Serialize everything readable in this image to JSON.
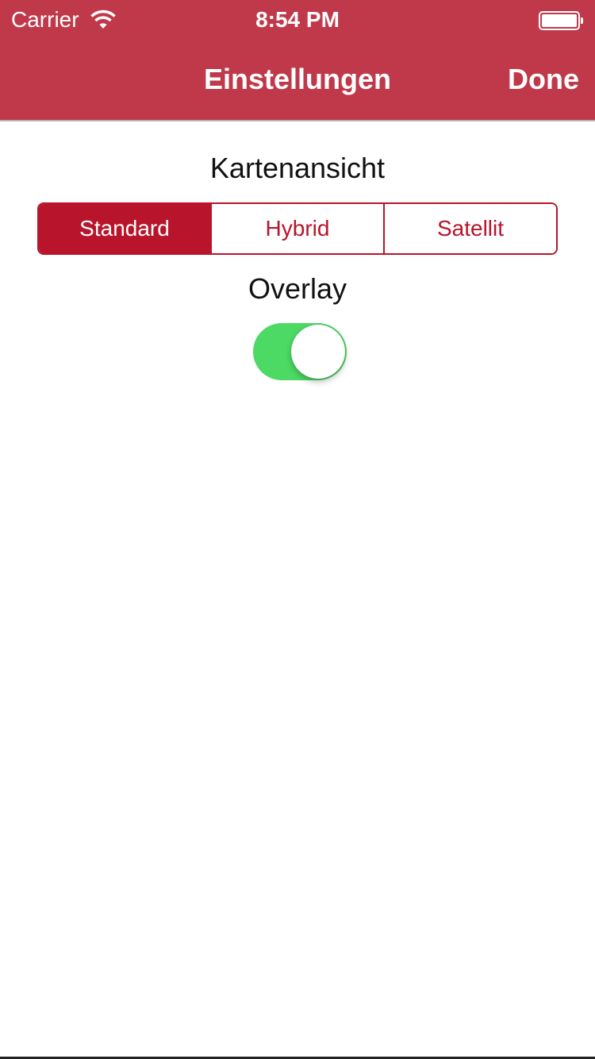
{
  "status_bar": {
    "carrier": "Carrier",
    "time": "8:54 PM",
    "battery_level": 1.0
  },
  "nav_bar": {
    "title": "Einstellungen",
    "done_label": "Done"
  },
  "map_view": {
    "title": "Kartenansicht",
    "segments": [
      "Standard",
      "Hybrid",
      "Satellit"
    ],
    "selected": "Standard"
  },
  "overlay": {
    "title": "Overlay",
    "enabled": true
  },
  "colors": {
    "nav_background": "#c0394a",
    "accent": "#b8142b",
    "toggle_on": "#4cd964"
  },
  "icons": {
    "wifi": "wifi-icon",
    "battery": "battery-icon"
  }
}
